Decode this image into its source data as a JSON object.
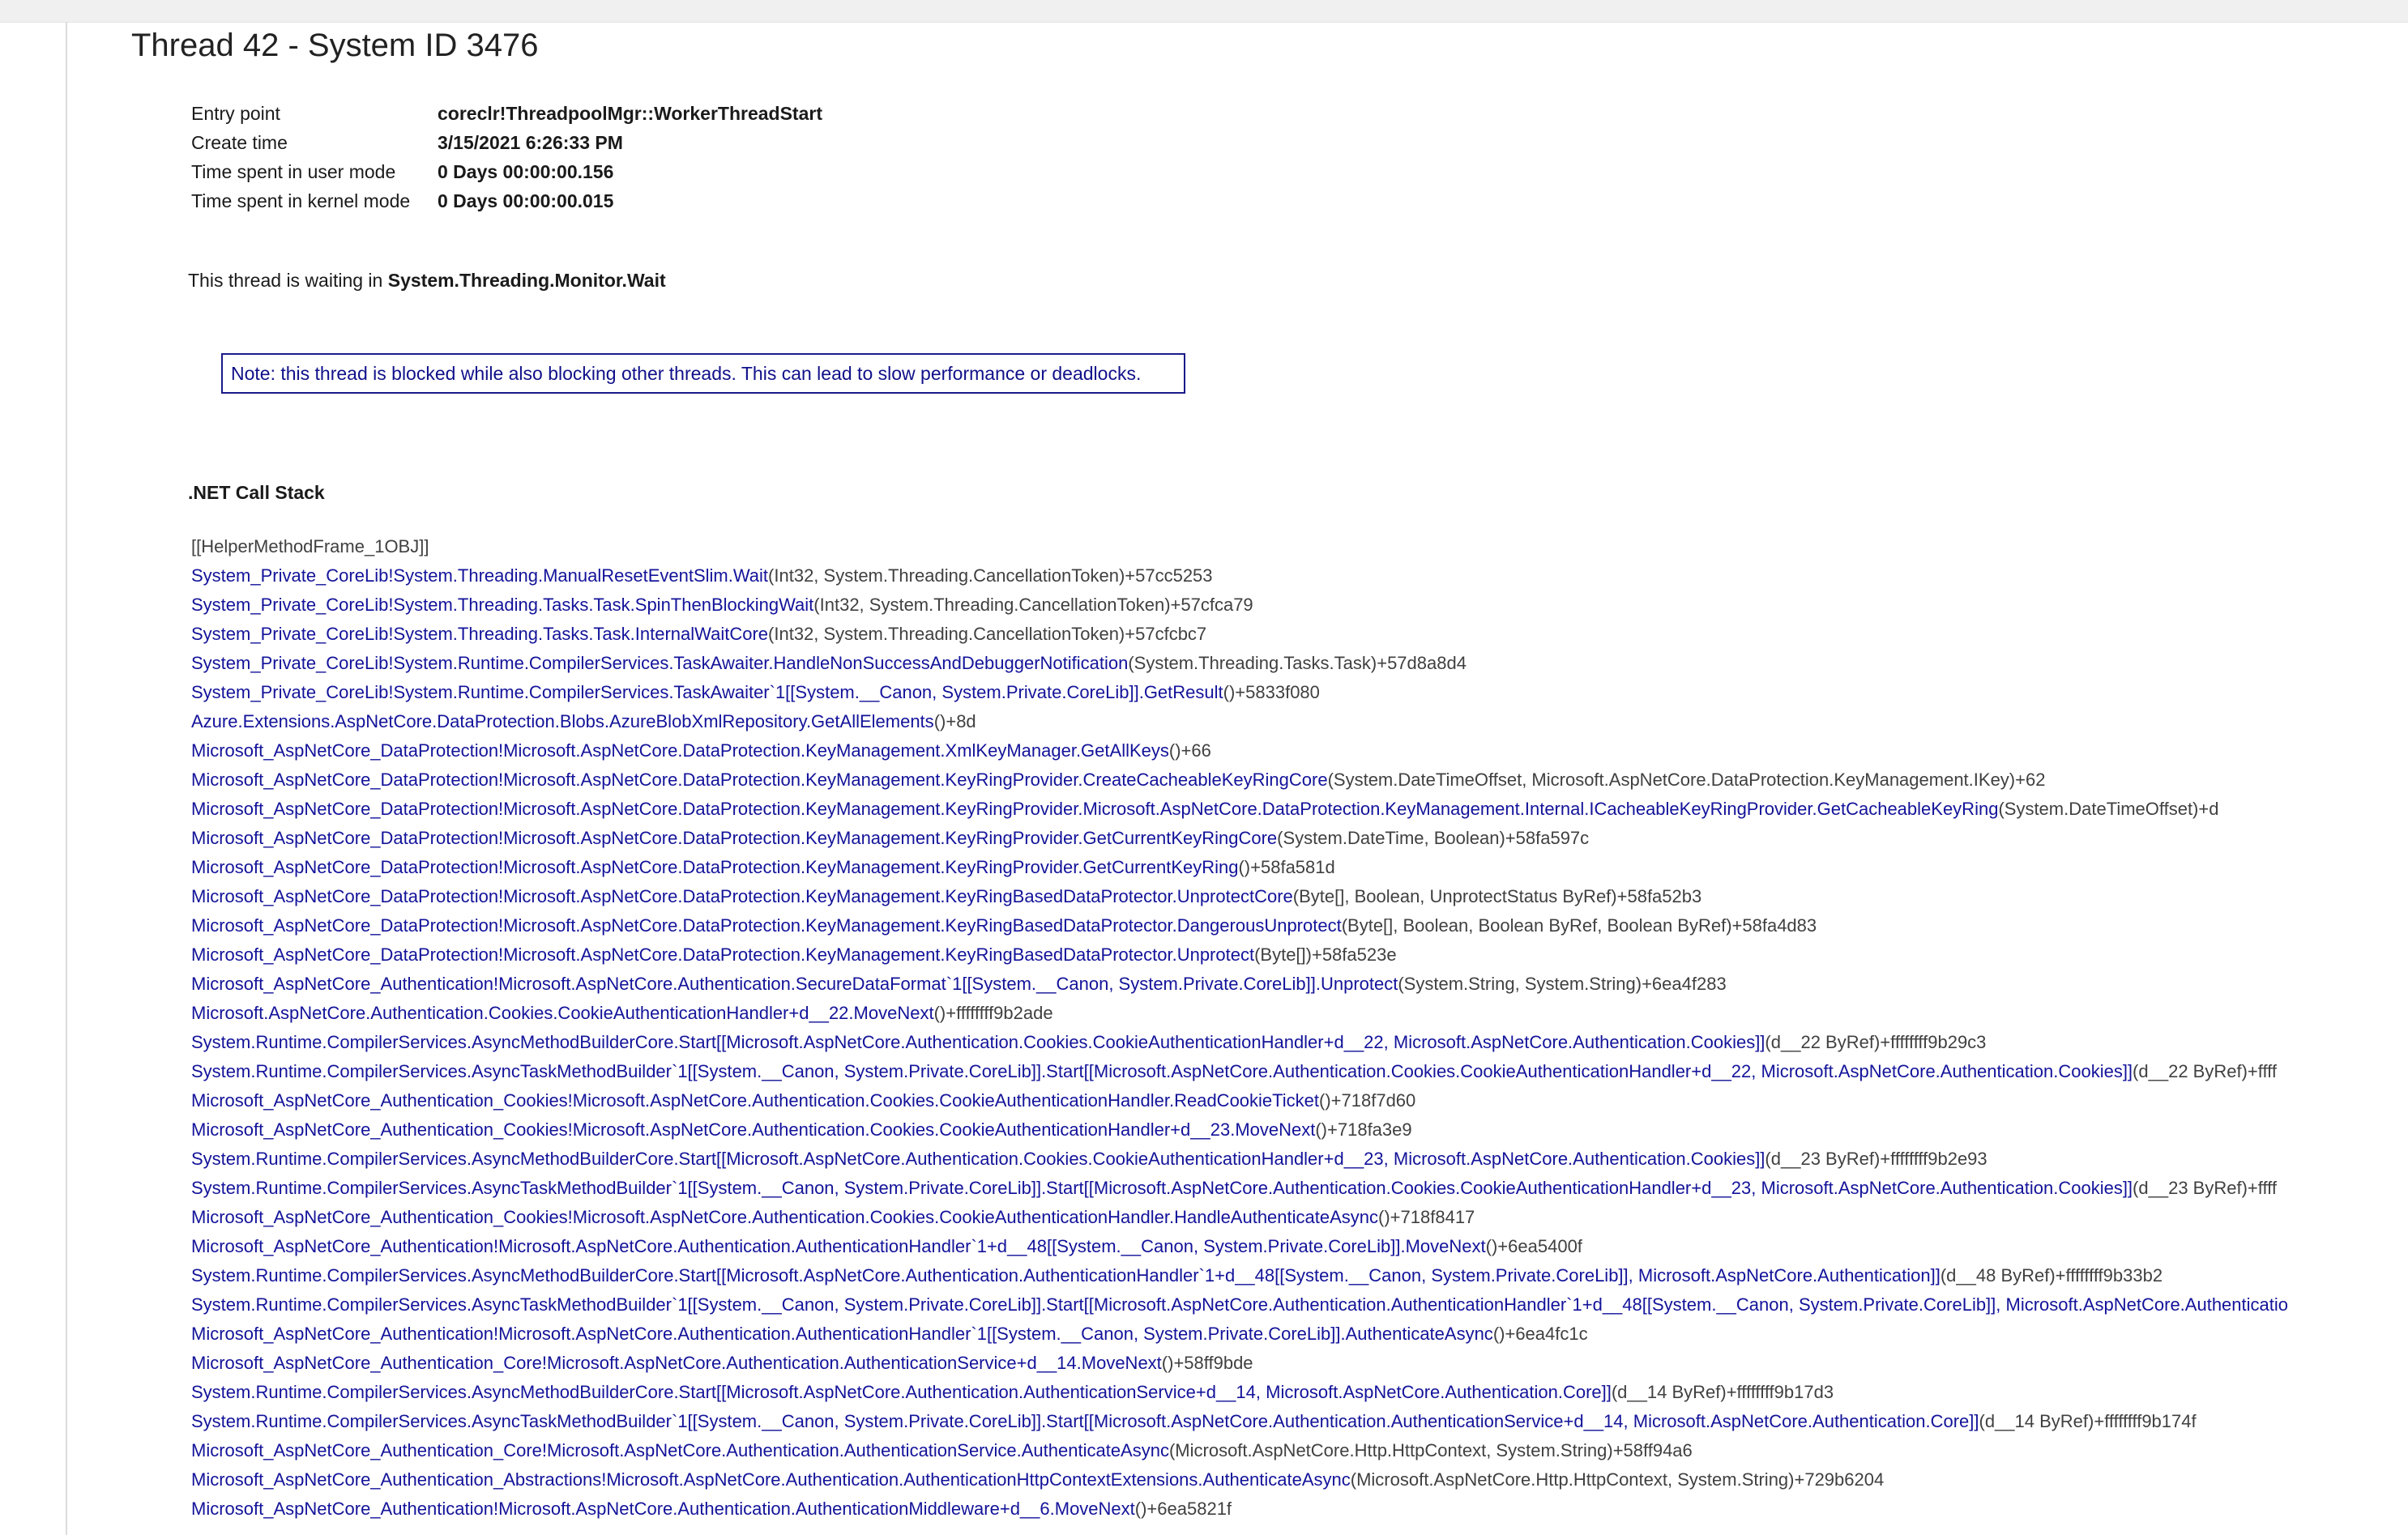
{
  "title": "Thread 42 - System ID 3476",
  "properties": [
    {
      "label": "Entry point",
      "value": "coreclr!ThreadpoolMgr::WorkerThreadStart"
    },
    {
      "label": "Create time",
      "value": "3/15/2021 6:26:33 PM"
    },
    {
      "label": "Time spent in user mode",
      "value": "0 Days 00:00:00.156"
    },
    {
      "label": "Time spent in kernel mode",
      "value": "0 Days 00:00:00.015"
    }
  ],
  "waiting": {
    "prefix": "This thread is waiting in ",
    "method": "System.Threading.Monitor.Wait"
  },
  "note": "Note: this thread is blocked while also blocking other threads. This can lead to slow performance or deadlocks.",
  "stack_heading": ".NET Call Stack",
  "frames": [
    {
      "plain": "[[HelperMethodFrame_1OBJ]]"
    },
    {
      "method": "System_Private_CoreLib!System.Threading.ManualResetEventSlim.Wait",
      "args": "(Int32, System.Threading.CancellationToken)+57cc5253"
    },
    {
      "method": "System_Private_CoreLib!System.Threading.Tasks.Task.SpinThenBlockingWait",
      "args": "(Int32, System.Threading.CancellationToken)+57cfca79"
    },
    {
      "method": "System_Private_CoreLib!System.Threading.Tasks.Task.InternalWaitCore",
      "args": "(Int32, System.Threading.CancellationToken)+57cfcbc7"
    },
    {
      "method": "System_Private_CoreLib!System.Runtime.CompilerServices.TaskAwaiter.HandleNonSuccessAndDebuggerNotification",
      "args": "(System.Threading.Tasks.Task)+57d8a8d4"
    },
    {
      "method": "System_Private_CoreLib!System.Runtime.CompilerServices.TaskAwaiter`1[[System.__Canon, System.Private.CoreLib]].GetResult",
      "args": "()+5833f080"
    },
    {
      "method": "Azure.Extensions.AspNetCore.DataProtection.Blobs.AzureBlobXmlRepository.GetAllElements",
      "args": "()+8d"
    },
    {
      "method": "Microsoft_AspNetCore_DataProtection!Microsoft.AspNetCore.DataProtection.KeyManagement.XmlKeyManager.GetAllKeys",
      "args": "()+66"
    },
    {
      "method": "Microsoft_AspNetCore_DataProtection!Microsoft.AspNetCore.DataProtection.KeyManagement.KeyRingProvider.CreateCacheableKeyRingCore",
      "args": "(System.DateTimeOffset, Microsoft.AspNetCore.DataProtection.KeyManagement.IKey)+62"
    },
    {
      "method": "Microsoft_AspNetCore_DataProtection!Microsoft.AspNetCore.DataProtection.KeyManagement.KeyRingProvider.Microsoft.AspNetCore.DataProtection.KeyManagement.Internal.ICacheableKeyRingProvider.GetCacheableKeyRing",
      "args": "(System.DateTimeOffset)+d"
    },
    {
      "method": "Microsoft_AspNetCore_DataProtection!Microsoft.AspNetCore.DataProtection.KeyManagement.KeyRingProvider.GetCurrentKeyRingCore",
      "args": "(System.DateTime, Boolean)+58fa597c"
    },
    {
      "method": "Microsoft_AspNetCore_DataProtection!Microsoft.AspNetCore.DataProtection.KeyManagement.KeyRingProvider.GetCurrentKeyRing",
      "args": "()+58fa581d"
    },
    {
      "method": "Microsoft_AspNetCore_DataProtection!Microsoft.AspNetCore.DataProtection.KeyManagement.KeyRingBasedDataProtector.UnprotectCore",
      "args": "(Byte[], Boolean, UnprotectStatus ByRef)+58fa52b3"
    },
    {
      "method": "Microsoft_AspNetCore_DataProtection!Microsoft.AspNetCore.DataProtection.KeyManagement.KeyRingBasedDataProtector.DangerousUnprotect",
      "args": "(Byte[], Boolean, Boolean ByRef, Boolean ByRef)+58fa4d83"
    },
    {
      "method": "Microsoft_AspNetCore_DataProtection!Microsoft.AspNetCore.DataProtection.KeyManagement.KeyRingBasedDataProtector.Unprotect",
      "args": "(Byte[])+58fa523e"
    },
    {
      "method": "Microsoft_AspNetCore_Authentication!Microsoft.AspNetCore.Authentication.SecureDataFormat`1[[System.__Canon, System.Private.CoreLib]].Unprotect",
      "args": "(System.String, System.String)+6ea4f283"
    },
    {
      "method": "Microsoft.AspNetCore.Authentication.Cookies.CookieAuthenticationHandler+d__22.MoveNext",
      "args": "()+ffffffff9b2ade"
    },
    {
      "method": "System.Runtime.CompilerServices.AsyncMethodBuilderCore.Start[[Microsoft.AspNetCore.Authentication.Cookies.CookieAuthenticationHandler+d__22, Microsoft.AspNetCore.Authentication.Cookies]]",
      "args": "(d__22 ByRef)+ffffffff9b29c3"
    },
    {
      "method": "System.Runtime.CompilerServices.AsyncTaskMethodBuilder`1[[System.__Canon, System.Private.CoreLib]].Start[[Microsoft.AspNetCore.Authentication.Cookies.CookieAuthenticationHandler+d__22, Microsoft.AspNetCore.Authentication.Cookies]]",
      "args": "(d__22 ByRef)+ffff"
    },
    {
      "method": "Microsoft_AspNetCore_Authentication_Cookies!Microsoft.AspNetCore.Authentication.Cookies.CookieAuthenticationHandler.ReadCookieTicket",
      "args": "()+718f7d60"
    },
    {
      "method": "Microsoft_AspNetCore_Authentication_Cookies!Microsoft.AspNetCore.Authentication.Cookies.CookieAuthenticationHandler+d__23.MoveNext",
      "args": "()+718fa3e9"
    },
    {
      "method": "System.Runtime.CompilerServices.AsyncMethodBuilderCore.Start[[Microsoft.AspNetCore.Authentication.Cookies.CookieAuthenticationHandler+d__23, Microsoft.AspNetCore.Authentication.Cookies]]",
      "args": "(d__23 ByRef)+ffffffff9b2e93"
    },
    {
      "method": "System.Runtime.CompilerServices.AsyncTaskMethodBuilder`1[[System.__Canon, System.Private.CoreLib]].Start[[Microsoft.AspNetCore.Authentication.Cookies.CookieAuthenticationHandler+d__23, Microsoft.AspNetCore.Authentication.Cookies]]",
      "args": "(d__23 ByRef)+ffff"
    },
    {
      "method": "Microsoft_AspNetCore_Authentication_Cookies!Microsoft.AspNetCore.Authentication.Cookies.CookieAuthenticationHandler.HandleAuthenticateAsync",
      "args": "()+718f8417"
    },
    {
      "method": "Microsoft_AspNetCore_Authentication!Microsoft.AspNetCore.Authentication.AuthenticationHandler`1+d__48[[System.__Canon, System.Private.CoreLib]].MoveNext",
      "args": "()+6ea5400f"
    },
    {
      "method": "System.Runtime.CompilerServices.AsyncMethodBuilderCore.Start[[Microsoft.AspNetCore.Authentication.AuthenticationHandler`1+d__48[[System.__Canon, System.Private.CoreLib]], Microsoft.AspNetCore.Authentication]]",
      "args": "(d__48 ByRef)+ffffffff9b33b2"
    },
    {
      "method": "System.Runtime.CompilerServices.AsyncTaskMethodBuilder`1[[System.__Canon, System.Private.CoreLib]].Start[[Microsoft.AspNetCore.Authentication.AuthenticationHandler`1+d__48[[System.__Canon, System.Private.CoreLib]], Microsoft.AspNetCore.Authenticatio",
      "args": ""
    },
    {
      "method": "Microsoft_AspNetCore_Authentication!Microsoft.AspNetCore.Authentication.AuthenticationHandler`1[[System.__Canon, System.Private.CoreLib]].AuthenticateAsync",
      "args": "()+6ea4fc1c"
    },
    {
      "method": "Microsoft_AspNetCore_Authentication_Core!Microsoft.AspNetCore.Authentication.AuthenticationService+d__14.MoveNext",
      "args": "()+58ff9bde"
    },
    {
      "method": "System.Runtime.CompilerServices.AsyncMethodBuilderCore.Start[[Microsoft.AspNetCore.Authentication.AuthenticationService+d__14, Microsoft.AspNetCore.Authentication.Core]]",
      "args": "(d__14 ByRef)+ffffffff9b17d3"
    },
    {
      "method": "System.Runtime.CompilerServices.AsyncTaskMethodBuilder`1[[System.__Canon, System.Private.CoreLib]].Start[[Microsoft.AspNetCore.Authentication.AuthenticationService+d__14, Microsoft.AspNetCore.Authentication.Core]]",
      "args": "(d__14 ByRef)+ffffffff9b174f"
    },
    {
      "method": "Microsoft_AspNetCore_Authentication_Core!Microsoft.AspNetCore.Authentication.AuthenticationService.AuthenticateAsync",
      "args": "(Microsoft.AspNetCore.Http.HttpContext, System.String)+58ff94a6"
    },
    {
      "method": "Microsoft_AspNetCore_Authentication_Abstractions!Microsoft.AspNetCore.Authentication.AuthenticationHttpContextExtensions.AuthenticateAsync",
      "args": "(Microsoft.AspNetCore.Http.HttpContext, System.String)+729b6204"
    },
    {
      "method": "Microsoft_AspNetCore_Authentication!Microsoft.AspNetCore.Authentication.AuthenticationMiddleware+d__6.MoveNext",
      "args": "()+6ea5821f"
    }
  ]
}
